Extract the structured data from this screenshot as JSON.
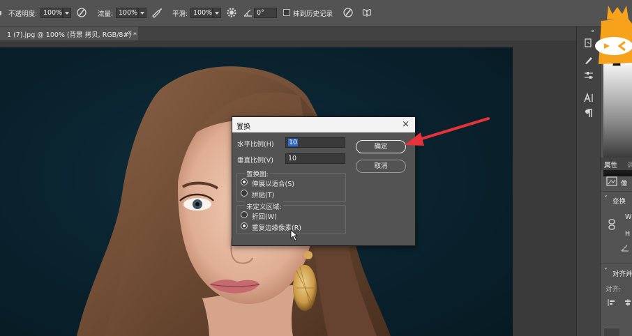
{
  "options_bar": {
    "opacity_label": "不透明度:",
    "opacity_value": "100%",
    "flow_label": "流量:",
    "flow_value": "100%",
    "smoothing_label": "平滑:",
    "smoothing_value": "100%",
    "angle_value": "0°",
    "erase_history_label": "抹到历史记录"
  },
  "document_tab": {
    "title": "1 (7).jpg @ 100% (背景 拷贝, RGB/8#) *",
    "close": "×"
  },
  "right_panel": {
    "collapse_left": "«",
    "collapse_right": "«",
    "properties_tab": "属性",
    "adjust_tab": "调",
    "pixel_layer_label": "像",
    "transform_label": "变换",
    "w_label": "W",
    "h_label": "H",
    "align_label": "对齐并",
    "align_sub_label": "对齐:"
  },
  "dialog": {
    "title": "置换",
    "close": "×",
    "horizontal_label": "水平比例(H)",
    "horizontal_value": "10",
    "vertical_label": "垂直比例(V)",
    "vertical_value": "10",
    "map_group_title": "置换图:",
    "map_option_stretch": "伸展以适合(S)",
    "map_option_tile": "拼贴(T)",
    "undefined_group_title": "未定义区域:",
    "undefined_option_wrap": "折回(W)",
    "undefined_option_repeat": "重复边缘像素(R)",
    "ok_button": "确定",
    "cancel_button": "取消"
  },
  "colors": {
    "accent_arrow": "#e8323a",
    "logo_orange": "#f6a21b",
    "selection_blue": "#2b6ad7"
  }
}
